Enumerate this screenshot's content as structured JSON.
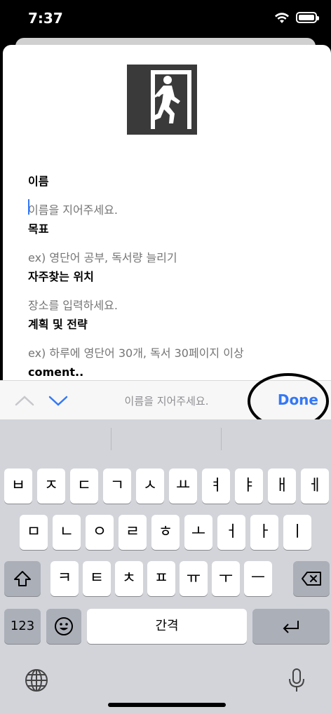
{
  "status_bar": {
    "time": "7:37"
  },
  "form": {
    "name_label": "이름",
    "name_placeholder": "이름을 지어주세요.",
    "goal_label": "목표",
    "goal_placeholder": "ex) 영단어 공부, 독서량 늘리기",
    "place_label": "자주찾는 위치",
    "place_placeholder": "장소를 입력하세요.",
    "plan_label": "계획 및 전략",
    "plan_placeholder": "ex) 하루에 영단어 30개, 독서 30페이지 이상",
    "comment_label": "coment.."
  },
  "accessory": {
    "title": "이름을 지어주세요.",
    "done_label": "Done",
    "up_icon": "chevron-up-icon",
    "down_icon": "chevron-down-icon"
  },
  "keyboard": {
    "row1": [
      "ㅂ",
      "ㅈ",
      "ㄷ",
      "ㄱ",
      "ㅅ",
      "ㅛ",
      "ㅕ",
      "ㅑ",
      "ㅐ",
      "ㅔ"
    ],
    "row2": [
      "ㅁ",
      "ㄴ",
      "ㅇ",
      "ㄹ",
      "ㅎ",
      "ㅗ",
      "ㅓ",
      "ㅏ",
      "ㅣ"
    ],
    "row3": [
      "ㅋ",
      "ㅌ",
      "ㅊ",
      "ㅍ",
      "ㅠ",
      "ㅜ",
      "ㅡ"
    ],
    "numbers_label": "123",
    "space_label": "간격",
    "emoji_icon": "emoji-icon",
    "globe_icon": "globe-icon",
    "mic_icon": "microphone-icon",
    "shift_icon": "shift-icon",
    "backspace_icon": "backspace-icon",
    "return_icon": "return-icon"
  },
  "colors": {
    "accent": "#3478f6",
    "keyboard_bg": "#d2d4da",
    "function_key": "#abafb8"
  }
}
